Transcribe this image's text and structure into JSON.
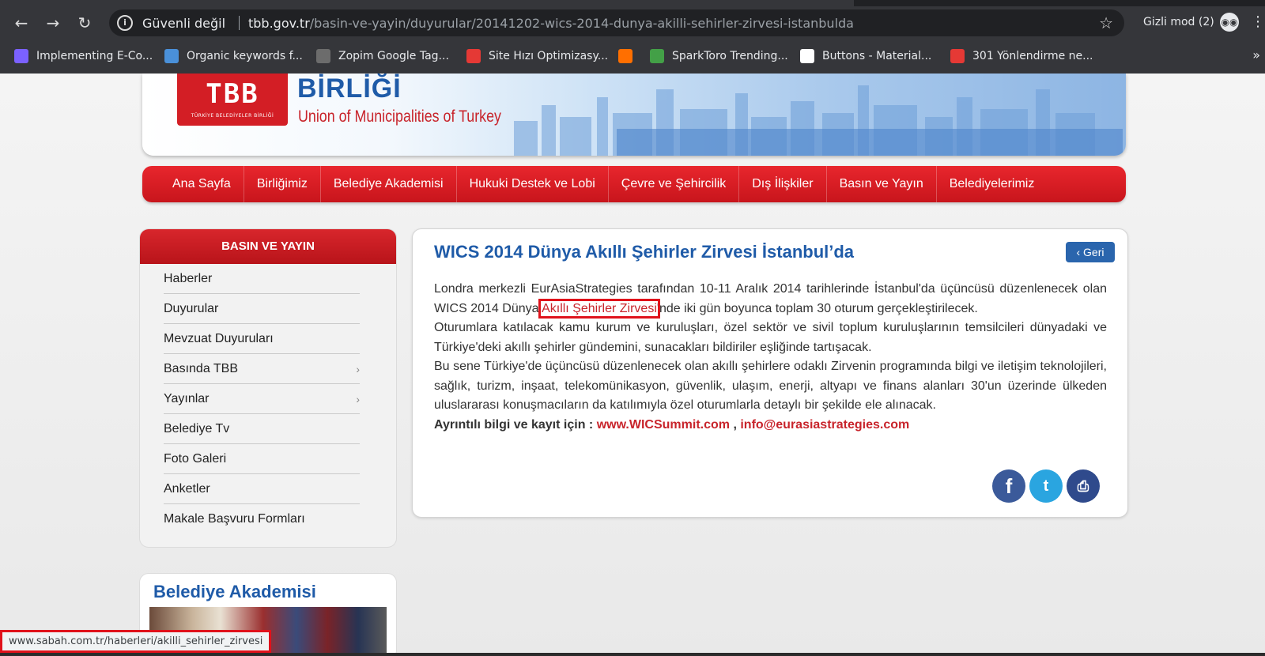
{
  "browser": {
    "security_label": "Güvenli değil",
    "url_host": "tbb.gov.tr",
    "url_path": "/basin-ve-yayin/duyurular/20141202-wics-2014-dunya-akilli-sehirler-zirvesi-istanbulda",
    "incognito_label": "Gizli mod (2)",
    "bookmarks": [
      {
        "label": "Implementing E-Co...",
        "color": "#7b61ff"
      },
      {
        "label": "Organic keywords f...",
        "color": "#4a90d9"
      },
      {
        "label": "Zopim Google Tag...",
        "color": "#6c6c6c"
      },
      {
        "label": "Site Hızı Optimizasy...",
        "color": "#e53935"
      },
      {
        "label": "",
        "color": "#ff6f00"
      },
      {
        "label": "SparkToro Trending...",
        "color": "#43a047"
      },
      {
        "label": "Buttons - Material...",
        "color": "#ffffff"
      },
      {
        "label": "301 Yönlendirme ne...",
        "color": "#e53935"
      }
    ],
    "bookmarks_more": "»",
    "status_url": "www.sabah.com.tr/haberleri/akilli_sehirler_zirvesi"
  },
  "header": {
    "logo_text": "TBB",
    "logo_subtext": "TÜRKİYE BELEDİYELER BİRLİĞİ",
    "org_name": "BİRLİĞİ",
    "org_subtitle": "Union of Municipalities of Turkey"
  },
  "nav": {
    "items": [
      "Ana Sayfa",
      "Birliğimiz",
      "Belediye Akademisi",
      "Hukuki Destek ve Lobi",
      "Çevre ve Şehircilik",
      "Dış İlişkiler",
      "Basın ve Yayın",
      "Belediyelerimiz"
    ]
  },
  "sidebar": {
    "title": "BASIN VE YAYIN",
    "items": [
      {
        "label": "Haberler",
        "chevron": ""
      },
      {
        "label": "Duyurular",
        "chevron": ""
      },
      {
        "label": "Mevzuat Duyuruları",
        "chevron": ""
      },
      {
        "label": "Basında TBB",
        "chevron": "›"
      },
      {
        "label": "Yayınlar",
        "chevron": "›"
      },
      {
        "label": "Belediye Tv",
        "chevron": ""
      },
      {
        "label": "Foto Galeri",
        "chevron": ""
      },
      {
        "label": "Anketler",
        "chevron": ""
      },
      {
        "label": "Makale Başvuru Formları",
        "chevron": ""
      }
    ],
    "academy_title": "Belediye Akademisi"
  },
  "article": {
    "title": "WICS 2014 Dünya Akıllı Şehirler Zirvesi İstanbul’da",
    "back_label": "Geri",
    "p1_before": "Londra merkezli EurAsiaStrategies tarafından 10-11 Aralık 2014 tarihlerinde İstanbul'da üçüncüsü düzenlenecek olan WICS 2014 Dünya ",
    "p1_link": "Akıllı Şehirler Zirvesi",
    "p1_after": "'nde iki gün boyunca toplam 30 oturum gerçekleştirilecek.",
    "p2": "Oturumlara katılacak kamu kurum ve kuruluşları, özel sektör ve sivil toplum kuruluşlarının temsilcileri dünyadaki ve Türkiye'deki akıllı şehirler gündemini, sunacakları bildiriler eşliğinde tartışacak.",
    "p3": "Bu sene Türkiye'de üçüncüsü düzenlenecek olan akıllı şehirlere odaklı Zirvenin programında bilgi ve iletişim teknolojileri, sağlık, turizm, inşaat, telekomünikasyon, güvenlik, ulaşım, enerji, altyapı ve finans alanları 30'un üzerinde ülkeden uluslararası konuşmacıların da katılımıyla özel oturumlarla detaylı bir şekilde ele alınacak.",
    "info_label": "Ayrıntılı bilgi ve kayıt için : ",
    "link_site": "www.WICSummit.com",
    "link_sep": " , ",
    "link_email": "info@eurasiastrategies.com",
    "share": {
      "facebook": "f",
      "twitter": "t",
      "print": "⎙"
    }
  },
  "colors": {
    "brand_red": "#d31e25",
    "brand_blue": "#1f5ba8",
    "highlight": "#e0121b"
  }
}
